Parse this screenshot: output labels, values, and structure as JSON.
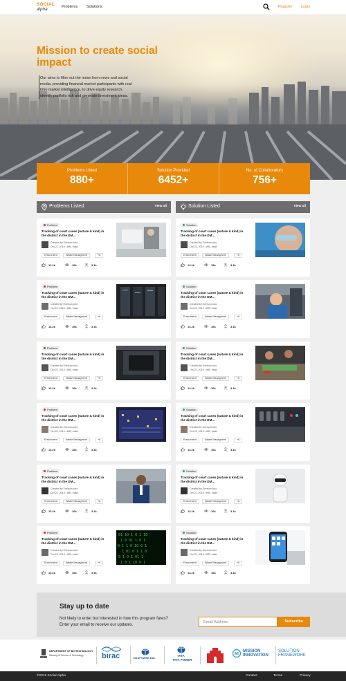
{
  "header": {
    "logo_line1": "SOCIAL",
    "logo_line2": "alpha",
    "nav": [
      "Problems",
      "Solutions"
    ],
    "register": "Register",
    "login": "Login"
  },
  "hero": {
    "title": "Mission to create social impact",
    "body_lines": [
      "Our aims to filter out the noise from news and social",
      "media, providing financial market participants with real-",
      "time market intelligence, to drive equity research,",
      "identify portfolio risk and generate investment ideas."
    ]
  },
  "stats": [
    {
      "label": "Problems Listed",
      "value": "880+"
    },
    {
      "label": "Solution Provided",
      "value": "6452+"
    },
    {
      "label": "No. of Collaborators",
      "value": "756+"
    }
  ],
  "problems_section": {
    "title": "Problems Listed",
    "view_all": "View all"
  },
  "solutions_section": {
    "title": "Solution Listed",
    "view_all": "View all"
  },
  "card_common": {
    "title_line1": "Tracking of court cases (nature & kind) in",
    "title_line2": "the district in the DM...",
    "created_by": "Created by Everson zoio",
    "date_location": "Oct 22, 2019 • WB, India",
    "tags": [
      "Enviroment",
      "Waste Managment",
      "+6"
    ],
    "likes": "13.2k",
    "views": "16k",
    "collaborators": "3.1k"
  },
  "problem_badge": "Problem",
  "solution_badge": "Solution",
  "newsletter": {
    "title": "Stay up to date",
    "body_line1": "Not likely to enter but interested in how this program fares?",
    "body_line2": "Enter your email to receive our updates.",
    "placeholder": "Email Address",
    "button": "Subscribe"
  },
  "partners": {
    "dbt_line1": "DEPARTMENT OF BIOTECHNOLOGY",
    "dbt_line2": "Ministry of Science & Technology",
    "birac": "birac",
    "tata_power_ddl": "TATAPOWER-DDL",
    "tata": "TATA",
    "tata_power": "TATA POWER",
    "mission_line1": "MISSION",
    "mission_line2": "INNOVATION",
    "framework_line1": "SOLUTION",
    "framework_line2": "FRAMEWORK"
  },
  "footer": {
    "copyright": "©2019 Social Alpha",
    "links": [
      "Contact",
      "Terms",
      "Privacy"
    ]
  },
  "colors": {
    "accent": "#e8890b",
    "problem_dot": "#d12d2d",
    "solution_dot": "#2aa84a",
    "section_bar": "#6d6d6d",
    "footer_bg": "#262626"
  }
}
